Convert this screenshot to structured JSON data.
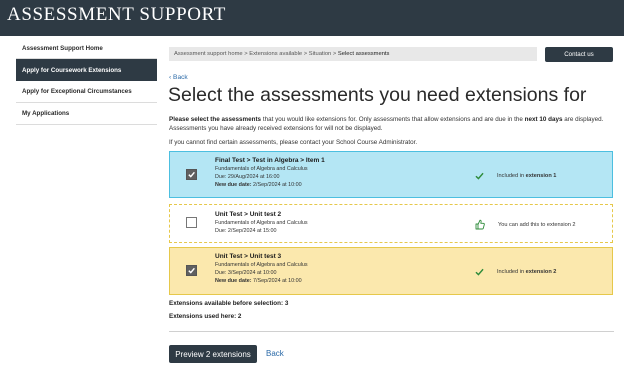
{
  "header": {
    "brand": "ASSESSMENT SUPPORT"
  },
  "sidebar": {
    "items": [
      {
        "label": "Assessment Support Home"
      },
      {
        "label": "Apply for Coursework Extensions"
      },
      {
        "label": "Apply for Exceptional Circumstances"
      },
      {
        "label": "My Applications"
      }
    ]
  },
  "breadcrumb": {
    "items": [
      "Assessment support home",
      "Extensions available",
      "Situation",
      "Select assessments"
    ],
    "separator": " > "
  },
  "contact_label": "Contact us",
  "back_label": "Back",
  "title": "Select the assessments you need extensions for",
  "intro": {
    "lead_bold": "Please select the assessments",
    "text1": " that you would like extensions for. Only assessments that allow extensions and are due in the ",
    "days_bold": "next 10 days",
    "text2": " are displayed. Assessments you have already received extensions for will not be displayed."
  },
  "note": "If you cannot find certain assessments, please contact your School Course Administrator.",
  "assessments": [
    {
      "name": "Final Test > Test in Algebra > Item 1",
      "course": "Fundamentals of Algebra and Calculus",
      "due": "Due: 29/Aug/2024 at 16:00",
      "new_due_label": "New due date:",
      "new_due_value": " 2/Sep/2024 at 10:00",
      "status_text": "Included in ",
      "status_bold": "extension 1",
      "checked": true
    },
    {
      "name": "Unit Test > Unit test 2",
      "course": "Fundamentals of Algebra and Calculus",
      "due": "Due: 2/Sep/2024 at 15:00",
      "status_text": "You can add this to extension 2",
      "checked": false
    },
    {
      "name": "Unit Test > Unit test 3",
      "course": "Fundamentals of Algebra and Calculus",
      "due": "Due: 3/Sep/2024 at 10:00",
      "new_due_label": "New due date:",
      "new_due_value": " 7/Sep/2024 at 10:00",
      "status_text": "Included in ",
      "status_bold": "extension 2",
      "checked": true
    }
  ],
  "stats": {
    "available": "Extensions available before selection: 3",
    "used": "Extensions used here: 2"
  },
  "actions": {
    "preview_label": "Preview 2 extensions",
    "back_label": "Back"
  },
  "colors": {
    "header_bg": "#2e3a44",
    "included_bg": "#b4e6f4",
    "included_border": "#4cbfe0",
    "warn_bg": "#fbe8ad",
    "warn_border": "#e6c84a",
    "link": "#2b6aa8",
    "check_green": "#2e8b3a"
  },
  "icons": {
    "included": "checkmark-icon",
    "available": "thumbs-up-icon",
    "back": "chevron-left-icon"
  }
}
